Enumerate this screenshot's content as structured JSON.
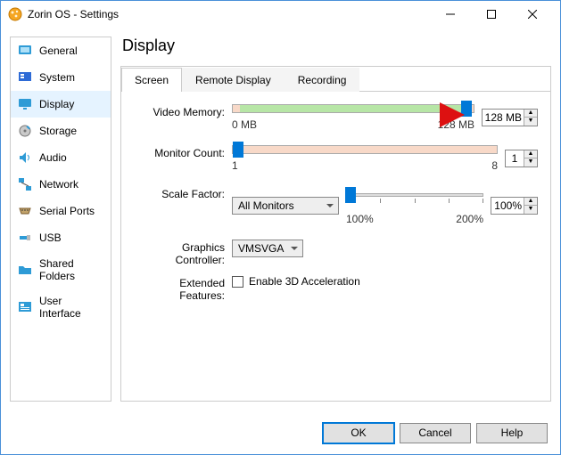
{
  "window": {
    "title": "Zorin OS - Settings"
  },
  "sidebar": {
    "items": [
      {
        "label": "General"
      },
      {
        "label": "System"
      },
      {
        "label": "Display"
      },
      {
        "label": "Storage"
      },
      {
        "label": "Audio"
      },
      {
        "label": "Network"
      },
      {
        "label": "Serial Ports"
      },
      {
        "label": "USB"
      },
      {
        "label": "Shared Folders"
      },
      {
        "label": "User Interface"
      }
    ]
  },
  "page": {
    "title": "Display"
  },
  "tabs": [
    {
      "label": "Screen"
    },
    {
      "label": "Remote Display"
    },
    {
      "label": "Recording"
    }
  ],
  "display": {
    "video_memory_label": "Video Memory:",
    "video_memory_value": "128 MB",
    "video_memory_min": "0 MB",
    "video_memory_max": "128 MB",
    "monitor_count_label": "Monitor Count:",
    "monitor_count_value": "1",
    "monitor_count_min": "1",
    "monitor_count_max": "8",
    "scale_factor_label": "Scale Factor:",
    "scale_factor_dropdown": "All Monitors",
    "scale_factor_value": "100%",
    "scale_min": "100%",
    "scale_max": "200%",
    "graphics_controller_label": "Graphics Controller:",
    "graphics_controller_value": "VMSVGA",
    "extended_features_label": "Extended Features:",
    "enable_3d_label": "Enable 3D Acceleration"
  },
  "buttons": {
    "ok": "OK",
    "cancel": "Cancel",
    "help": "Help"
  }
}
